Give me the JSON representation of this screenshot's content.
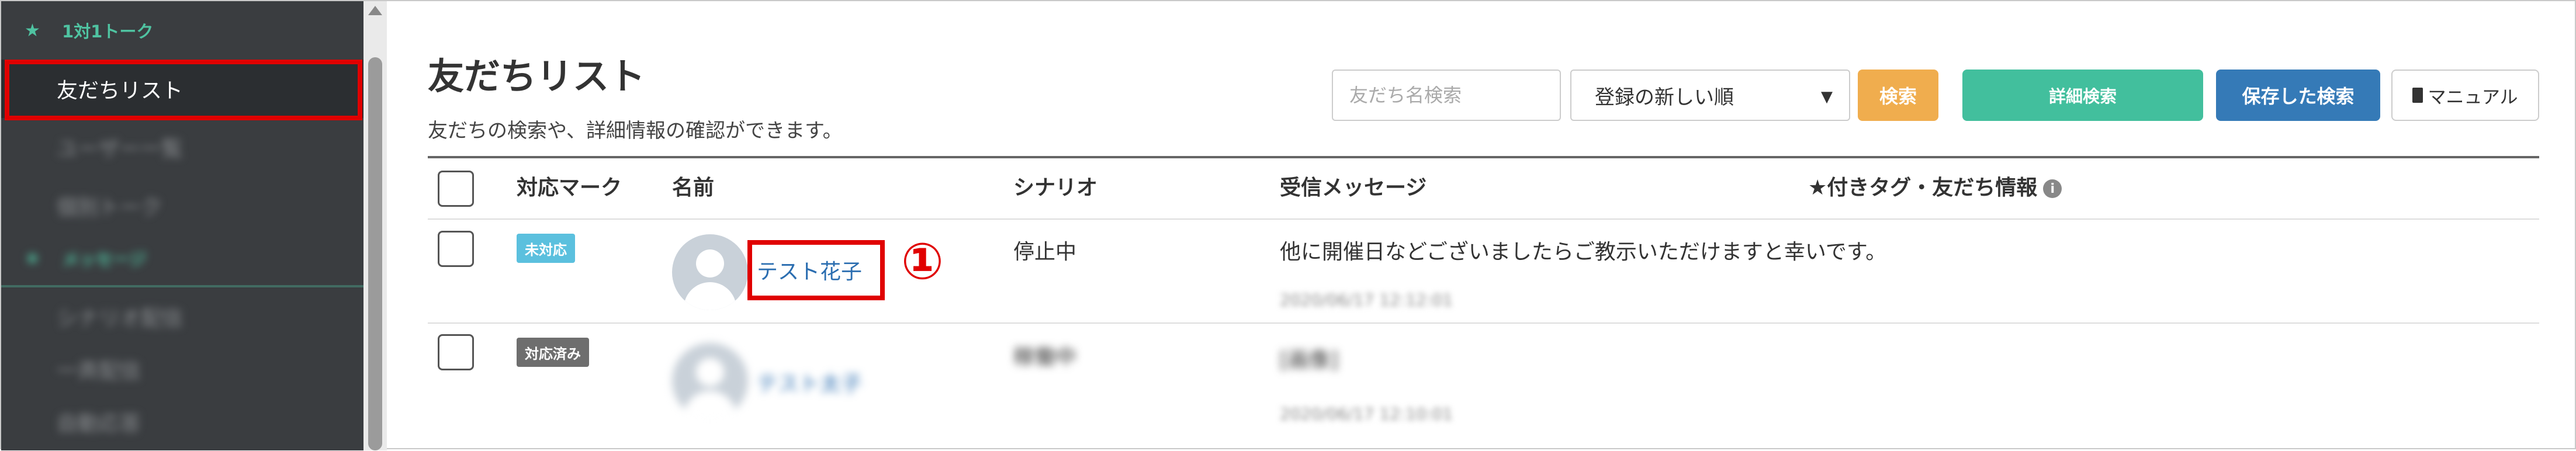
{
  "sidebar": {
    "section1": {
      "label": "1対1トーク",
      "icon": "star-icon"
    },
    "items": [
      {
        "label": "友だちリスト",
        "active": true
      },
      {
        "label": "ユーザー一覧"
      },
      {
        "label": "個別トーク"
      }
    ],
    "section2": {
      "label": "メッセージ",
      "icon": "star-icon"
    },
    "items2": [
      {
        "label": "シナリオ配信"
      },
      {
        "label": "一斉配信"
      },
      {
        "label": "自動応答"
      }
    ]
  },
  "header": {
    "title": "友だちリスト",
    "description": "友だちの検索や、詳細情報の確認ができます。"
  },
  "toolbar": {
    "search_placeholder": "友だち名検索",
    "sort_selected": "登録の新しい順",
    "search_label": "検索",
    "detail_search_label": "詳細検索",
    "saved_search_label": "保存した検索",
    "manual_label": "マニュアル"
  },
  "table": {
    "headers": {
      "mark": "対応マーク",
      "name": "名前",
      "scenario": "シナリオ",
      "message": "受信メッセージ",
      "tags": "★付きタグ・友だち情報"
    },
    "rows": [
      {
        "badge": "未対応",
        "name": "テスト花子",
        "scenario": "停止中",
        "message": "他に開催日などございましたらご教示いただけますと幸いです。",
        "date": "2020/06/17 12:12:01"
      },
      {
        "badge": "対応済み",
        "name": "テスト太子",
        "scenario": "稼働中",
        "message": "[画像]",
        "date": "2020/06/17 12:10:01"
      }
    ]
  },
  "annotation": {
    "number": "①"
  },
  "colors": {
    "highlight": "#e00000",
    "sidebar_bg": "#3a3d40",
    "accent_green": "#42bf9d",
    "search_orange": "#f0ad4e",
    "saved_blue": "#357ab7",
    "unhandled_badge": "#5bc0de"
  }
}
